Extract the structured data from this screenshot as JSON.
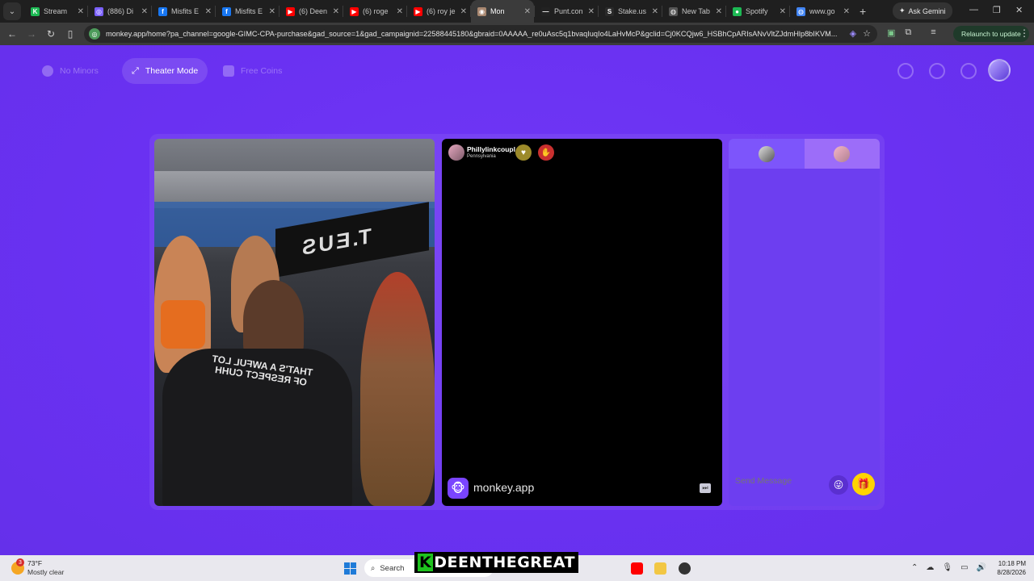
{
  "browser": {
    "tabs": [
      {
        "title": "Stream",
        "color": "#1db954",
        "glyph": "K"
      },
      {
        "title": "(886) Di",
        "color": "#7b61ff",
        "glyph": "◎"
      },
      {
        "title": "Misfits E",
        "color": "#1877f2",
        "glyph": "f"
      },
      {
        "title": "Misfits E",
        "color": "#1877f2",
        "glyph": "f"
      },
      {
        "title": "(6) Deen",
        "color": "#ff0000",
        "glyph": "▶"
      },
      {
        "title": "(6) roge",
        "color": "#ff0000",
        "glyph": "▶"
      },
      {
        "title": "(6) roy je",
        "color": "#ff0000",
        "glyph": "▶"
      },
      {
        "title": "Mon",
        "color": "#a88770",
        "glyph": "◉",
        "active": true
      },
      {
        "title": "Punt.con",
        "color": "#222222",
        "glyph": "—"
      },
      {
        "title": "Stake.us",
        "color": "#2a2a2a",
        "glyph": "S"
      },
      {
        "title": "New Tab",
        "color": "#555555",
        "glyph": "◍"
      },
      {
        "title": "Spotify",
        "color": "#1db954",
        "glyph": "●"
      },
      {
        "title": "www.go",
        "color": "#4285f4",
        "glyph": "◍"
      }
    ],
    "gemini_label": "Ask Gemini",
    "url": "monkey.app/home?pa_channel=google-GIMC-CPA-purchase&gad_source=1&gad_campaignid=22588445180&gbraid=0AAAAA_re0uAsc5q1bvaqIuqIo4LaHvMcP&gclid=Cj0KCQjw6_HSBhCpARIsANvVltZJdmHlp8bIKVM...",
    "relaunch_label": "Relaunch to update"
  },
  "app": {
    "nav": {
      "no_minors": "No Minors",
      "theater_mode": "Theater Mode",
      "free_coins": "Free Coins"
    },
    "left_video": {
      "banner_text": "T.EUS",
      "shirt_text_line1": "THAT'S A AWFUL LOT",
      "shirt_text_line2": "OF RESPECT CUHH"
    },
    "peer": {
      "name": "Phillylinkcoupl",
      "location": "Pennsylvania"
    },
    "brand_name": "monkey.app",
    "chat": {
      "placeholder": "Send Message"
    }
  },
  "taskbar": {
    "badge": "3",
    "temperature": "73°F",
    "condition": "Mostly clear",
    "search_label": "Search",
    "overlay_prefix": "K",
    "overlay_text": "DEENTHEGREAT",
    "time": "10:18 PM",
    "date": "8/28/2026"
  }
}
